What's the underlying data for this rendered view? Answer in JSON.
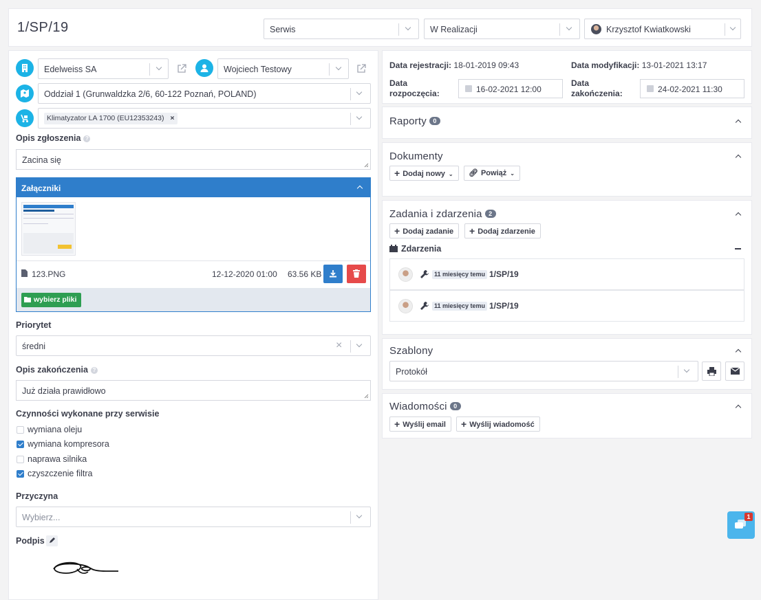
{
  "header": {
    "title": "1/SP/19",
    "type_value": "Serwis",
    "status_value": "W Realizacji",
    "assignee_value": "Krzysztof Kwiatkowski"
  },
  "left": {
    "client_value": "Edelweiss SA",
    "contact_value": "Wojciech Testowy",
    "location_value": "Oddział 1 (Grunwaldzka 2/6, 60-122 Poznań, POLAND)",
    "device_tag": "Klimatyzator LA 1700 (EU12353243)",
    "description_label": "Opis zgłoszenia",
    "description_value": "Zacina się",
    "attachments": {
      "title": "Załączniki",
      "file_name": "123.PNG",
      "file_date": "12-12-2020 01:00",
      "file_size": "63.56 KB",
      "choose_files_label": "wybierz pliki"
    },
    "priority_label": "Priorytet",
    "priority_value": "średni",
    "closing_label": "Opis zakończenia",
    "closing_value": "Już działa prawidłowo",
    "tasks_label": "Czynności wykonane przy serwisie",
    "tasks": [
      {
        "label": "wymiana oleju",
        "checked": false
      },
      {
        "label": "wymiana kompresora",
        "checked": true
      },
      {
        "label": "naprawa silnika",
        "checked": false
      },
      {
        "label": "czyszczenie filtra",
        "checked": true
      }
    ],
    "cause_label": "Przyczyna",
    "cause_placeholder": "Wybierz...",
    "signature_label": "Podpis"
  },
  "right": {
    "registration_label": "Data rejestracji:",
    "registration_value": "18-01-2019 09:43",
    "modification_label": "Data modyfikacji:",
    "modification_value": "13-01-2021 13:17",
    "start_label_1": "Data",
    "start_label_2": "rozpoczęcia:",
    "start_value": "16-02-2021 12:00",
    "end_label_1": "Data",
    "end_label_2": "zakończenia:",
    "end_value": "24-02-2021 11:30",
    "reports_title": "Raporty",
    "reports_count": "0",
    "documents_title": "Dokumenty",
    "add_new_label": "Dodaj nowy",
    "link_label": "Powiąż",
    "tasks_title": "Zadania i zdarzenia",
    "tasks_count": "2",
    "add_task_label": "Dodaj zadanie",
    "add_event_label": "Dodaj zdarzenie",
    "events_label": "Zdarzenia",
    "events": [
      {
        "time": "11 miesięcy temu",
        "ref": "1/SP/19"
      },
      {
        "time": "11 miesięcy temu",
        "ref": "1/SP/19"
      }
    ],
    "templates_title": "Szablony",
    "template_value": "Protokół",
    "messages_title": "Wiadomości",
    "messages_count": "0",
    "send_email_label": "Wyślij email",
    "send_message_label": "Wyślij wiadomość"
  },
  "chat_badge": "1",
  "colors": {
    "accent_cyan": "#1cb3e6",
    "panel_blue": "#2f7ecb",
    "danger": "#e64a4a",
    "success": "#2e9e52"
  }
}
